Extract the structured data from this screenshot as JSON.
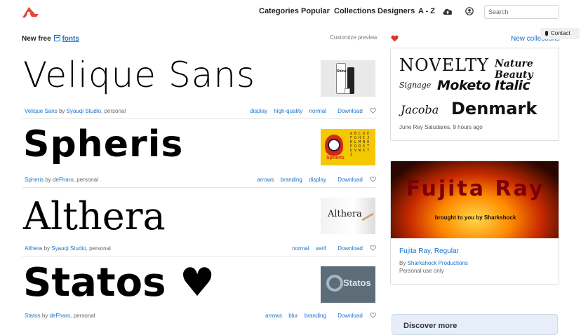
{
  "nav": {
    "items": [
      "Categories",
      "Popular",
      "Collections",
      "Designers",
      "A - Z"
    ],
    "search_placeholder": "Search",
    "cloud_icon": "cloud-upload-icon",
    "user_icon": "user-circle-icon"
  },
  "intro": {
    "new_free": "New free",
    "fonts_link": "fonts",
    "customize": "Customize preview"
  },
  "fonts": [
    {
      "specimen": "Velique Sans",
      "name": "Velique Sans",
      "by": "by",
      "designer": "Syauqi Studio",
      "license": ", personal",
      "tags": [
        "display",
        "high-quality",
        "normal"
      ],
      "download": "Download",
      "thumb": "Shine"
    },
    {
      "specimen": "Spheris",
      "name": "Spheris",
      "by": "by",
      "designer": "deFharo",
      "license": ", personal",
      "tags": [
        "arrows",
        "branding",
        "display"
      ],
      "download": "Download",
      "thumb": "Spheris"
    },
    {
      "specimen": "Althera",
      "name": "Althera",
      "by": "by",
      "designer": "Syauqi Studio",
      "license": ", personal",
      "tags": [
        "normal",
        "serif"
      ],
      "download": "Download",
      "thumb": "Althera"
    },
    {
      "specimen": "Statos ♥",
      "name": "Statos",
      "by": "by",
      "designer": "deFharo",
      "license": ", personal",
      "tags": [
        "arrows",
        "blur",
        "branding"
      ],
      "download": "Download",
      "thumb": "Statos"
    }
  ],
  "sidebar": {
    "new_collections": "New collections",
    "contact": "Contact",
    "collection": {
      "words": [
        "NOVELTY",
        "Nature Beauty",
        "Signage",
        "Moketo Italic",
        "Jacoba",
        "Denmark"
      ],
      "author_line": "June Rey Saludares, 9 hours ago"
    },
    "featured": {
      "banner_title": "Fujita Ray",
      "banner_sub": "brought to you by Sharkshock",
      "title": "Fujita Ray, Regular",
      "by": "By",
      "designer": "Sharkshock Productions",
      "license": "Personal use only"
    },
    "discover": "Discover more"
  },
  "colors": {
    "accent": "#e8463a",
    "link": "#1a73c8"
  }
}
